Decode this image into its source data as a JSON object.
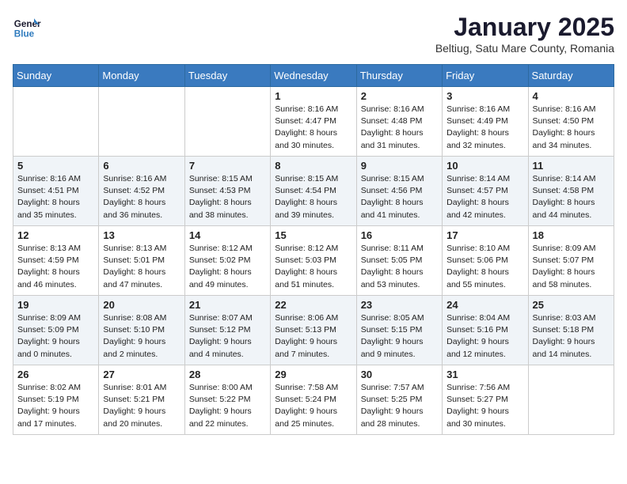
{
  "header": {
    "logo_line1": "General",
    "logo_line2": "Blue",
    "month": "January 2025",
    "location": "Beltiug, Satu Mare County, Romania"
  },
  "weekdays": [
    "Sunday",
    "Monday",
    "Tuesday",
    "Wednesday",
    "Thursday",
    "Friday",
    "Saturday"
  ],
  "weeks": [
    [
      {
        "day": "",
        "info": ""
      },
      {
        "day": "",
        "info": ""
      },
      {
        "day": "",
        "info": ""
      },
      {
        "day": "1",
        "info": "Sunrise: 8:16 AM\nSunset: 4:47 PM\nDaylight: 8 hours\nand 30 minutes."
      },
      {
        "day": "2",
        "info": "Sunrise: 8:16 AM\nSunset: 4:48 PM\nDaylight: 8 hours\nand 31 minutes."
      },
      {
        "day": "3",
        "info": "Sunrise: 8:16 AM\nSunset: 4:49 PM\nDaylight: 8 hours\nand 32 minutes."
      },
      {
        "day": "4",
        "info": "Sunrise: 8:16 AM\nSunset: 4:50 PM\nDaylight: 8 hours\nand 34 minutes."
      }
    ],
    [
      {
        "day": "5",
        "info": "Sunrise: 8:16 AM\nSunset: 4:51 PM\nDaylight: 8 hours\nand 35 minutes."
      },
      {
        "day": "6",
        "info": "Sunrise: 8:16 AM\nSunset: 4:52 PM\nDaylight: 8 hours\nand 36 minutes."
      },
      {
        "day": "7",
        "info": "Sunrise: 8:15 AM\nSunset: 4:53 PM\nDaylight: 8 hours\nand 38 minutes."
      },
      {
        "day": "8",
        "info": "Sunrise: 8:15 AM\nSunset: 4:54 PM\nDaylight: 8 hours\nand 39 minutes."
      },
      {
        "day": "9",
        "info": "Sunrise: 8:15 AM\nSunset: 4:56 PM\nDaylight: 8 hours\nand 41 minutes."
      },
      {
        "day": "10",
        "info": "Sunrise: 8:14 AM\nSunset: 4:57 PM\nDaylight: 8 hours\nand 42 minutes."
      },
      {
        "day": "11",
        "info": "Sunrise: 8:14 AM\nSunset: 4:58 PM\nDaylight: 8 hours\nand 44 minutes."
      }
    ],
    [
      {
        "day": "12",
        "info": "Sunrise: 8:13 AM\nSunset: 4:59 PM\nDaylight: 8 hours\nand 46 minutes."
      },
      {
        "day": "13",
        "info": "Sunrise: 8:13 AM\nSunset: 5:01 PM\nDaylight: 8 hours\nand 47 minutes."
      },
      {
        "day": "14",
        "info": "Sunrise: 8:12 AM\nSunset: 5:02 PM\nDaylight: 8 hours\nand 49 minutes."
      },
      {
        "day": "15",
        "info": "Sunrise: 8:12 AM\nSunset: 5:03 PM\nDaylight: 8 hours\nand 51 minutes."
      },
      {
        "day": "16",
        "info": "Sunrise: 8:11 AM\nSunset: 5:05 PM\nDaylight: 8 hours\nand 53 minutes."
      },
      {
        "day": "17",
        "info": "Sunrise: 8:10 AM\nSunset: 5:06 PM\nDaylight: 8 hours\nand 55 minutes."
      },
      {
        "day": "18",
        "info": "Sunrise: 8:09 AM\nSunset: 5:07 PM\nDaylight: 8 hours\nand 58 minutes."
      }
    ],
    [
      {
        "day": "19",
        "info": "Sunrise: 8:09 AM\nSunset: 5:09 PM\nDaylight: 9 hours\nand 0 minutes."
      },
      {
        "day": "20",
        "info": "Sunrise: 8:08 AM\nSunset: 5:10 PM\nDaylight: 9 hours\nand 2 minutes."
      },
      {
        "day": "21",
        "info": "Sunrise: 8:07 AM\nSunset: 5:12 PM\nDaylight: 9 hours\nand 4 minutes."
      },
      {
        "day": "22",
        "info": "Sunrise: 8:06 AM\nSunset: 5:13 PM\nDaylight: 9 hours\nand 7 minutes."
      },
      {
        "day": "23",
        "info": "Sunrise: 8:05 AM\nSunset: 5:15 PM\nDaylight: 9 hours\nand 9 minutes."
      },
      {
        "day": "24",
        "info": "Sunrise: 8:04 AM\nSunset: 5:16 PM\nDaylight: 9 hours\nand 12 minutes."
      },
      {
        "day": "25",
        "info": "Sunrise: 8:03 AM\nSunset: 5:18 PM\nDaylight: 9 hours\nand 14 minutes."
      }
    ],
    [
      {
        "day": "26",
        "info": "Sunrise: 8:02 AM\nSunset: 5:19 PM\nDaylight: 9 hours\nand 17 minutes."
      },
      {
        "day": "27",
        "info": "Sunrise: 8:01 AM\nSunset: 5:21 PM\nDaylight: 9 hours\nand 20 minutes."
      },
      {
        "day": "28",
        "info": "Sunrise: 8:00 AM\nSunset: 5:22 PM\nDaylight: 9 hours\nand 22 minutes."
      },
      {
        "day": "29",
        "info": "Sunrise: 7:58 AM\nSunset: 5:24 PM\nDaylight: 9 hours\nand 25 minutes."
      },
      {
        "day": "30",
        "info": "Sunrise: 7:57 AM\nSunset: 5:25 PM\nDaylight: 9 hours\nand 28 minutes."
      },
      {
        "day": "31",
        "info": "Sunrise: 7:56 AM\nSunset: 5:27 PM\nDaylight: 9 hours\nand 30 minutes."
      },
      {
        "day": "",
        "info": ""
      }
    ]
  ]
}
